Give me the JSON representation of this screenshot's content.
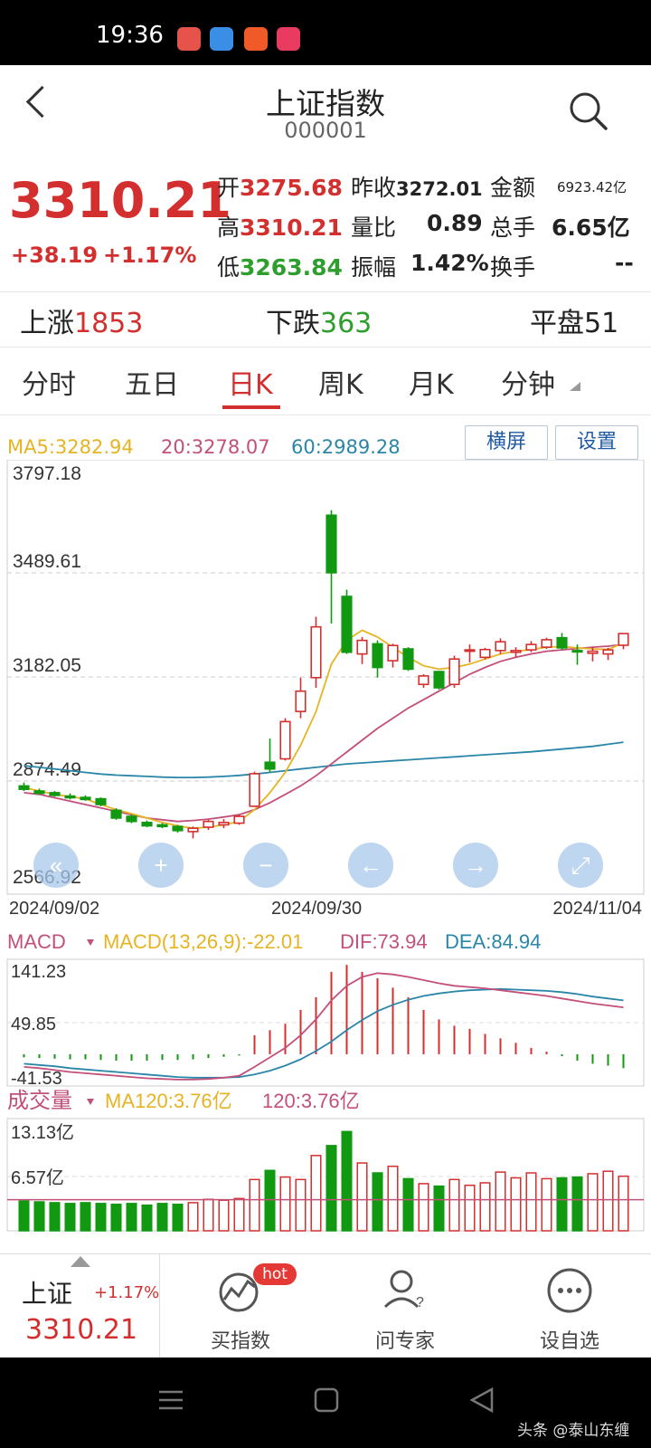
{
  "status_bar": {
    "time": "19:36"
  },
  "header": {
    "title": "上证指数",
    "code": "000001"
  },
  "quote": {
    "price": "3310.21",
    "change": "+38.19",
    "change_pct": "+1.17%",
    "open_label": "开",
    "open": "3275.68",
    "prev_close_label": "昨收",
    "prev_close": "3272.01",
    "amount_label": "金额",
    "amount": "6923.42亿",
    "high_label": "高",
    "high": "3310.21",
    "vol_ratio_label": "量比",
    "vol_ratio": "0.89",
    "total_hands_label": "总手",
    "total_hands": "6.65亿",
    "low_label": "低",
    "low": "3263.84",
    "amplitude_label": "振幅",
    "amplitude": "1.42%",
    "turnover_label": "换手",
    "turnover": "--"
  },
  "breadth": {
    "up_label": "上涨",
    "up": "1853",
    "down_label": "下跌",
    "down": "363",
    "flat_label": "平盘",
    "flat": "51"
  },
  "tabs": [
    "分时",
    "五日",
    "日K",
    "周K",
    "月K",
    "分钟"
  ],
  "active_tab": "日K",
  "indicators": {
    "ma5": "MA5:3282.94",
    "ma20": "20:3278.07",
    "ma60": "60:2989.28",
    "landscape_btn": "横屏",
    "settings_btn": "设置"
  },
  "price_axis": [
    "3797.18",
    "3489.61",
    "3182.05",
    "2874.49",
    "2566.92"
  ],
  "date_axis": [
    "2024/09/02",
    "2024/09/30",
    "2024/11/04"
  ],
  "macd": {
    "label": "MACD",
    "params": "MACD(13,26,9):-22.01",
    "dif": "DIF:73.94",
    "dea": "DEA:84.94",
    "axis": [
      "141.23",
      "49.85",
      "-41.53"
    ]
  },
  "volume": {
    "label": "成交量",
    "ma120": "MA120:3.76亿",
    "v120": "120:3.76亿",
    "axis": [
      "13.13亿",
      "6.57亿"
    ]
  },
  "bottom_nav": {
    "index_name": "上证",
    "index_pct": "+1.17%",
    "index_price": "3310.21",
    "buy_index": "买指数",
    "hot_badge": "hot",
    "ask_expert": "问专家",
    "add_watch": "设自选"
  },
  "watermark": "头条 @泰山东缠",
  "colors": {
    "up": "#d32f2f",
    "down": "#119911",
    "ma5": "#e6b422",
    "ma20": "#c2507a",
    "ma60": "#2a86a8"
  },
  "chart_data": {
    "type": "candlestick",
    "ylim": [
      2566.92,
      3797.18
    ],
    "candles": [
      {
        "o": 2860,
        "h": 2870,
        "l": 2845,
        "c": 2850
      },
      {
        "o": 2845,
        "h": 2852,
        "l": 2835,
        "c": 2838
      },
      {
        "o": 2840,
        "h": 2845,
        "l": 2828,
        "c": 2832
      },
      {
        "o": 2830,
        "h": 2838,
        "l": 2820,
        "c": 2825
      },
      {
        "o": 2826,
        "h": 2832,
        "l": 2816,
        "c": 2820
      },
      {
        "o": 2822,
        "h": 2826,
        "l": 2800,
        "c": 2805
      },
      {
        "o": 2788,
        "h": 2794,
        "l": 2760,
        "c": 2765
      },
      {
        "o": 2770,
        "h": 2775,
        "l": 2750,
        "c": 2755
      },
      {
        "o": 2752,
        "h": 2758,
        "l": 2738,
        "c": 2742
      },
      {
        "o": 2745,
        "h": 2750,
        "l": 2735,
        "c": 2740
      },
      {
        "o": 2740,
        "h": 2745,
        "l": 2722,
        "c": 2728
      },
      {
        "o": 2725,
        "h": 2740,
        "l": 2705,
        "c": 2735
      },
      {
        "o": 2738,
        "h": 2760,
        "l": 2730,
        "c": 2755
      },
      {
        "o": 2745,
        "h": 2762,
        "l": 2735,
        "c": 2752
      },
      {
        "o": 2750,
        "h": 2775,
        "l": 2745,
        "c": 2770
      },
      {
        "o": 2800,
        "h": 2902,
        "l": 2798,
        "c": 2896
      },
      {
        "o": 2930,
        "h": 3000,
        "l": 2900,
        "c": 2910
      },
      {
        "o": 2940,
        "h": 3060,
        "l": 2935,
        "c": 3050
      },
      {
        "o": 3080,
        "h": 3180,
        "l": 3060,
        "c": 3140
      },
      {
        "o": 3180,
        "h": 3360,
        "l": 3150,
        "c": 3330
      },
      {
        "o": 3660,
        "h": 3675,
        "l": 3340,
        "c": 3490
      },
      {
        "o": 3420,
        "h": 3440,
        "l": 3250,
        "c": 3255
      },
      {
        "o": 3250,
        "h": 3300,
        "l": 3220,
        "c": 3290
      },
      {
        "o": 3280,
        "h": 3290,
        "l": 3180,
        "c": 3210
      },
      {
        "o": 3230,
        "h": 3280,
        "l": 3210,
        "c": 3275
      },
      {
        "o": 3265,
        "h": 3270,
        "l": 3200,
        "c": 3205
      },
      {
        "o": 3160,
        "h": 3190,
        "l": 3150,
        "c": 3185
      },
      {
        "o": 3198,
        "h": 3200,
        "l": 3145,
        "c": 3150
      },
      {
        "o": 3160,
        "h": 3245,
        "l": 3150,
        "c": 3235
      },
      {
        "o": 3258,
        "h": 3278,
        "l": 3225,
        "c": 3262
      },
      {
        "o": 3240,
        "h": 3268,
        "l": 3234,
        "c": 3263
      },
      {
        "o": 3260,
        "h": 3296,
        "l": 3250,
        "c": 3286
      },
      {
        "o": 3255,
        "h": 3270,
        "l": 3240,
        "c": 3260
      },
      {
        "o": 3262,
        "h": 3288,
        "l": 3255,
        "c": 3278
      },
      {
        "o": 3270,
        "h": 3298,
        "l": 3265,
        "c": 3292
      },
      {
        "o": 3298,
        "h": 3312,
        "l": 3262,
        "c": 3268
      },
      {
        "o": 3260,
        "h": 3278,
        "l": 3218,
        "c": 3256
      },
      {
        "o": 3252,
        "h": 3270,
        "l": 3228,
        "c": 3258
      },
      {
        "o": 3250,
        "h": 3268,
        "l": 3232,
        "c": 3262
      },
      {
        "o": 3275.68,
        "h": 3310.21,
        "l": 3263.84,
        "c": 3310.21
      }
    ],
    "ma5": [
      2855,
      2845,
      2835,
      2828,
      2822,
      2805,
      2790,
      2778,
      2765,
      2752,
      2742,
      2735,
      2738,
      2745,
      2755,
      2790,
      2840,
      2900,
      2980,
      3080,
      3220,
      3290,
      3320,
      3300,
      3270,
      3240,
      3215,
      3205,
      3210,
      3220,
      3235,
      3250,
      3258,
      3263,
      3270,
      3272,
      3268,
      3265,
      3263,
      3282.94
    ],
    "ma20": [
      2840,
      2835,
      2825,
      2815,
      2805,
      2795,
      2785,
      2775,
      2765,
      2760,
      2755,
      2758,
      2762,
      2768,
      2775,
      2790,
      2810,
      2835,
      2860,
      2890,
      2925,
      2960,
      2995,
      3030,
      3060,
      3090,
      3115,
      3140,
      3165,
      3190,
      3210,
      3228,
      3240,
      3250,
      3258,
      3262,
      3266,
      3270,
      3273,
      3278.07
    ],
    "ma60": [
      2920,
      2915,
      2910,
      2905,
      2900,
      2895,
      2892,
      2890,
      2888,
      2886,
      2885,
      2885,
      2886,
      2888,
      2891,
      2895,
      2900,
      2905,
      2910,
      2915,
      2920,
      2925,
      2928,
      2931,
      2934,
      2937,
      2940,
      2943,
      2946,
      2949,
      2952,
      2955,
      2958,
      2961,
      2965,
      2969,
      2973,
      2977,
      2983,
      2989.28
    ],
    "macd_ylim": [
      -41.53,
      141.23
    ],
    "macd_hist": [
      -5,
      -6,
      -7,
      -8,
      -8,
      -9,
      -10,
      -10,
      -10,
      -9,
      -9,
      -8,
      -6,
      -4,
      -2,
      30,
      38,
      48,
      70,
      90,
      130,
      141,
      130,
      120,
      105,
      90,
      70,
      55,
      45,
      40,
      32,
      25,
      18,
      10,
      4,
      -3,
      -10,
      -15,
      -18,
      -22.01
    ],
    "dif": [
      -20,
      -22,
      -25,
      -28,
      -30,
      -32,
      -34,
      -36,
      -38,
      -39,
      -40,
      -40,
      -39,
      -37,
      -34,
      -20,
      -5,
      10,
      30,
      55,
      85,
      108,
      122,
      128,
      126,
      122,
      117,
      112,
      108,
      106,
      104,
      101,
      98,
      95,
      92,
      88,
      84,
      80,
      77,
      73.94
    ],
    "dea": [
      -15,
      -17,
      -19,
      -22,
      -24,
      -26,
      -28,
      -30,
      -32,
      -34,
      -36,
      -37,
      -37,
      -37,
      -36,
      -32,
      -26,
      -18,
      -8,
      5,
      20,
      38,
      54,
      68,
      78,
      86,
      92,
      96,
      99,
      101,
      102,
      103,
      102,
      101,
      100,
      98,
      95,
      91,
      88,
      84.94
    ],
    "volume_ylim": [
      0,
      13.13
    ],
    "volume": [
      3.6,
      3.5,
      3.4,
      3.3,
      3.4,
      3.3,
      3.2,
      3.3,
      3.1,
      3.3,
      3.2,
      3.4,
      3.8,
      3.7,
      3.9,
      6.2,
      7.3,
      6.5,
      6.2,
      9.1,
      10.3,
      12.0,
      8.2,
      7.0,
      7.8,
      6.3,
      5.7,
      5.4,
      6.2,
      5.5,
      5.8,
      7.1,
      6.4,
      7.0,
      6.3,
      6.4,
      6.5,
      6.9,
      7.2,
      6.6
    ]
  }
}
